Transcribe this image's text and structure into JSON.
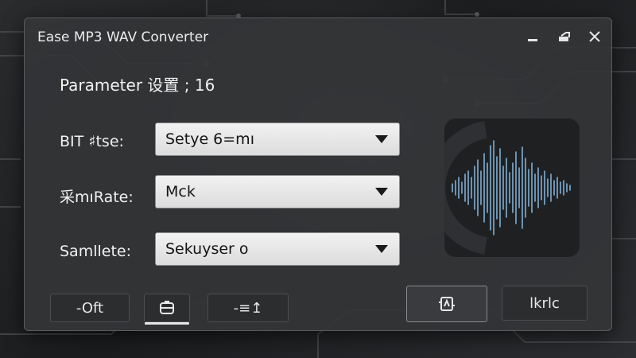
{
  "window": {
    "title": "Ease MP3 WAV Converter"
  },
  "heading": "Parameter 设置 ; 16",
  "fields": [
    {
      "label": "BIT ♯tse:",
      "value": "Setye 6=mı"
    },
    {
      "label": "采mıRate:",
      "value": "Mck"
    },
    {
      "label": "Samllete:",
      "value": "Sekuyser o"
    }
  ],
  "buttons": {
    "oft_label": "-Oft",
    "expand_label": "-≡↥",
    "last_label": "lkrlc"
  },
  "icons": {
    "minimize": "minimize-icon",
    "restore": "restore-icon",
    "close": "close-icon",
    "waveform": "audio-waveform-icon",
    "save": "save-icon",
    "convert": "convert-icon"
  },
  "colors": {
    "accent": "#7fb0d6",
    "window_bg": "#343537",
    "field_bg": "#e8e8e8"
  }
}
